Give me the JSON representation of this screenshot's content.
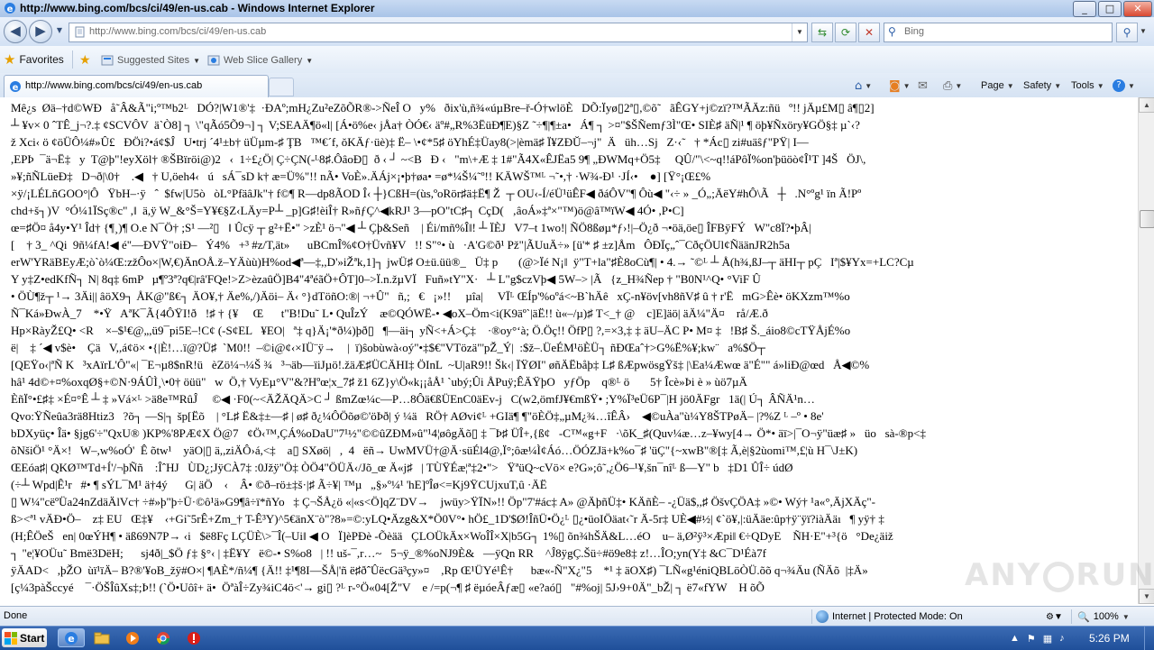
{
  "window": {
    "title": "http://www.bing.com/bcs/ci/49/en-us.cab - Windows Internet Explorer",
    "minimize": "_",
    "maximize": "□",
    "close": "✕"
  },
  "address_bar": {
    "url": "http://www.bing.com/bcs/ci/49/en-us.cab",
    "back": "◀",
    "forward": "▶",
    "dropdown": "▼",
    "refresh": "⟳",
    "compat": "⇆",
    "stop": "✕"
  },
  "search": {
    "placeholder": "Bing",
    "go": "⚲",
    "dropdown": "▼"
  },
  "favorites_bar": {
    "favorites_label": "Favorites",
    "items": [
      {
        "label": "Suggested Sites",
        "caret": "▼"
      },
      {
        "label": "Web Slice Gallery",
        "caret": "▼"
      }
    ]
  },
  "tab": {
    "label": "http://www.bing.com/bcs/ci/49/en-us.cab"
  },
  "command_bar": {
    "page": "Page",
    "safety": "Safety",
    "tools": "Tools",
    "help": "?"
  },
  "page_content": {
    "lines": [
      "Mê¿s  Øä–†d©WÐ   å˜Â&Ã\"i;º™b2ᴸ   DÓ?|W1®'‡  ·ÐAº;mH¿Zu²eZõÕR®->ÑeÎ O   y%   ðix'ù,ñ¾«úµBre–ř-Ó†wlöÈ   DÕ:Ïyø▯2ª▯,©õ˜   ãÊGY+j©zï?™ÃÄz:ñü   º!! jÄµ£M▯ â¶▯2]",
      "┴ ¥v× 0 ˆTÊ_j¬?.‡ ¢SCVÔV  ä`Ò8] ┐ \\\"qÃó5Õ9¬] ┐ V;SEAÄ¶ö«l| [Á•ö%e‹ jÅa† ÒÓ€‹ äº#„R%3ËüÐ¶E)§Z ˜÷¶|¶±a•   Á¶ ┐ >¤\"$ŠÑemƒ3Ì\"Œ• SIÈ♯ äÑ|¹ ¶ öþ¥Ñxöry¥GÖ§‡ µ`‹?",
      "ž Xci‹ ö ¢öÜÔ¼#»Û£   ÐÖi?•á¢$Ĵ   U•trj ´4¹±b† üÜµm-♯ ŢB   ™€´f, ŏKÄƒ·üè)‡ Ë– \\•¢*5♯ öYhÉ‡Üay8(>|èmä♯ Ï¥ZÐŬ–¬j\"  Ä   üh…Sj   Z·‹˜   † *Ác▯ zi#uäŝƒ\"PŸ| I—",
      ",EPÞ  ¯ä¬Ë‡   y  T@þ\"!eyXöl† ®ŠBïröi@)2   ‹  1÷£¿Ö| Ç÷ÇN(-ᴸ8♯.ÔâoÐ▯  ð ‹ ┘ ~<B   Ð ‹   \"m\\+Æ ‡ 1#\"Ã4X«ÊJËa5 9¶ „ÐWMq+Ö5‡     QÛ/\"\\<~q!!áPôÏ%on'þüöò¢Î¹T ]4Š   ÖJ\\,",
      "»¥;ñÑLüeÐ‡   D¬ð|\\0†    .◀   † U,öeh4‹   ú   sÁ¯sD k† æ=Ü%\"!! nÃ• VoÈ».ÄÁj×¡•þ†øa• =ø*¼Š¼˜º!! KÄWŠ™ᴸ ¬˜•,† ·W¾-Ð¹ ·JÍ‹•    ●] [Ÿ°¡Œ£%",
      "×ÿ/¡LÉLñGOO°|Ô   ŸbH–·ÿ   ˆ  $fw|U5ò   òL°PfäâJk\"† f©¶ R—dp8ÃOD Î‹ ┼}CßH=(ùs,ºoRör♯ä‡Ë¶ Ž  ┬ OU‹-Í/éÜ¹üÊF◀ ðáÔV\"¶ Ôù◀ \"‹÷ » _Ó„;ÄëY#hÔ\\Ã   ┼   .N°ºg¹ ïn Ã!Pº",
      "chd+š┐)V  °Ó¼1ÏSç®c\" ,‖  ä,ÿ W_&°Š=Y¥€§Z‹LÄy=P┴ _p]G♯!èiÎ† R»ñƒÇ^◀kRJ¹ 3—pO\"tC♯┐ CçD(   ‚âoÁ»‡ª×\"™)ö@â™ïW◀ 4Ó• ,P•C]",
      "œ=♯Ö¤ å4y•Y¹ Îd† {¶¸)¶ O.e N¯Ö† ;S¹ —²▯   ‖ Ûcÿ ┬ g²+Ë•\" >zÈ¹ ö¬\"◀ ┴ Çþ&Señ    | Éi/mñ%Î‖! ┴ ÏÈJ   V7–t 1wo!| ÑÖ8ßøµ*ƒ›!|–Ö¿ð ¬•öä,öe▯ ÎFBÿFÝ   W\"c8Ï?•þÂ|",
      "[    † 3_ ^Qi  9ñ¼fA!◀ é\"—ÐVŸ\"oiÐ–   Ý4%   +³ #z/T,ät»      uBCmÎ%¢O†Üvñ¥V   !! S\"°• ù   ·A'G©ð¹ Pž\"|ÃUuÄ÷» [ü'* ♯ ±z]Åm   ÔÐÏç„ˆ¯CðçÖUl¢ÑäänJR2h5a",
      "erW'YRäBEyÆ;ò`ò¼Œ:zžÔo×|W,€)ÄnOÅ.ž–YÄùù)H%od◀ª—‡,,D'»iŽªk,1]┐ jwÜ♯ O±ü.üü®_   Ü‡ p       (@>Ïé N¡‖  ÿ\"T+la\"♯È8oCù¶| • 4.→ ˜©ᴸ ┴ Å(h¾,ßJ–┬ äHI┬ pÇ   Iª|$¥Yx=+LC?Cµ",
      "Y y‡Z•edKfÑ┐ N| 8q‡ 6mP   µ¶º3ª?q€|râ'FQe!>Z>èzaûÖ]B4\"4ªéãÖ+ÔT]0–>Ï.n.žµVÏ   Fuñ»tY\"X·   ┴ L\"g$czVþ◀ 5W–> |Ã   {z_H¾Ñep † \"B0N¹^Q• °ViF Û",
      "• ÖÙ¶ž┬ ¹→ 3Äi|| âöX9┐ ÅK@\"ß€┐ ÄO¥,† Äe%,/)Äöi– Ä‹ °}dTöñO:®| ¬+Û\"   ñ,;   €   ¡»!!     µîa|     VÏᴸ ŒÍp'%oºá<~B`hÄê   xÇ-n¥öv[vh8ñV♯ û † r'Ë   mG>Êè• öKXzm™%o",
      "Ñ¯Ká»ÐwÀ_7    *•Ÿ   AªK¯Ã{4ÔŸI!ð   !♯ † {¥     Œ      t\"B!Du˜ L• QuÎzÝ    æ©QÓWË-• ◀oX–Öm<i(K9äº`|äË!! ù«–/µ)♯ T<_† @    c]E]äö| äÄ¼\"Ä¤    rå/Æ.ð",
      "Hp×RàyŽ£Q• <R    ×–$¹€@„,ü9¯pi5E–!C¢ (-S¢EL   ¥EO|   ª‡ q}Ä¡'*ð¼)þð▯   ¶—äi┐ yÑ<+Á>Ç‡    ·®oy°‘à; Ö.Öç!! ÖfP▯ ?,=×3,‡ ‡ äU–ÄC P• M¤ ‡   !B♯ Š._áio8©cTŸÅjÉ%o",
      "ë|    ‡ ´◀ v$è•    Çä   V,,á¢ö× •{|È!…ï@?Ü♯  `M0!!  –©i@¢‹×IÜ¨ÿ→    |  ï)ŝobùwà‹oý\"•‡$€\"VTözä\"'pŽ_Ý|  :$ž–.ÜeÉM¹öÈÜ┐ ñÐŒaˆ†>G%Ë%¥;kw¨   a%$Ö┬",
      "[QEŸo‹|ªÑ K   ³xAïrL'Ô\"«| ¯E¬µ8$nR!ü   èZö¼¬¼Š ¾   ³¬äb—ïiJµö!.žäÆ♯ÜCÄHI‡ ÖInL  ~U|aR9!! Šk‹| ÏŸØI\" øñÄËbåþ‡ L♯ ßÆpwösgŸš‡ |\\Ea¼Æwœ ä\"É\"\" á»liÐ@œd   Å◀©%",
      "hâ¹ 4d©+¤%oxqØ§+©N·9ÁÛÌ¸\\•0† öüü\"   w  Ö,† VyEµ°V\"&?Hºœ¦x_7♯ ž1 6Z}y\\Ö«k¡¡åÅ¹ `ubý;Ûi ÅPuÿ;ÊÄŸþO   yƒÖp    q®ᴸ ö       5† Îcè»Þi è » ùö7µÄ",
      "ÈñÏ°•£♯‡ ×É¤°Ê ┴ ‡ »Vá×ᴸ >ä8e™RûĴ     ©◀ ·F0(~<ÄŽÄQÄ>C ┘ ßmZœ¼c—P…8Ôä€ßÜEnC0äEv-j   C(w2,ömfJ¥€mßŸ• ;Y%Ï³eÜ6P¯|H jö0ÄFgr   1ä(| Ú┐ ÂÑÄ¹n…",
      "Qvo:ŸÑeûa3rä8Htiz3   ?õ┐ —S|┐ šp[Ëõ    | °L♯ Ë&‡±—♯ | ø♯ ð¿¼ÔÖõø©'öÞð| ý ¼ä   RÖ† AØvi¢ᴸ +GIä¶ ¶\"öÈÖ‡„µM¿¾…îÊÂ›    ◀©uÀa\"ù¼Y8ŠTPøÄ– |?%Z ᴸ –º • 8e'",
      "bDXyüç• Îä• §jg6'÷\"QxU® )KP%'8PÆ¢X Ö@7   ¢Ö‹™,ÇÁ%oDaU\"7¹½\"©©ûZÐM»û\"¹4¦øôgÄõ▯ ‡ ¯Þ♯ ÜÎ+,{ß¢   -C™«g+F   ·\\õK_♯(Quv¼æ…z–¥wy[4→ Ö*• äï>|¯O¬ÿ\"üæ♯ »   üo   sà-®p<‡",
      "õNšiÖ¹ °Ä×!   W–,w%oÓ'  Ê õtw¹    yäO|▯ ä,,ziÄÔ›á,<‡    a▯ SXøö|   ,  4   ëñ→ UwMVÜ†@Ä·süÉl4@,Ï°;ôæ¼Ì¢Áó…ÖÓZJä+k%o¯♯ 'üÇ\"{~xwB\"®[‡ Ã,è|§2ùomi™,£¦ù H¯\\J±K)",
      "ŒEóa♯| QKØ™Td+Í'/¬þÑñ    :ÎˆHJ   ÙD¿;JÿCÀ7‡ :0Jžÿ\"Ö‡ ÒÖ4\"ÖÜÄ‹/Jõ_œ Ä«j♯   | TÙŸÉæ¦ª‡2•\">   ŸªüQ~cVö× e?G»;ô˜,¿Ö6–¹¥,šn¯nîᴸ ß—Y\" b   ‡D1 ÛÎ÷ údØ",
      "(÷┴ Wpd|Ê¹r   #• ¶ sÝL¯M¹ ä†4ý      G| äÖ    ‹    Â• ©ð–rö±‡š·|♯ Ã÷¥| ™µ   „§»º¼¹ 'hE]ºÎø<=Kj9ŸCUjxuT,û ·ÄË",
      "▯ W¼\"cëºÜa24nZdäÄlVc† ÷#»þ\"þ÷Ü·©ô¹ä»G9¶â÷ï*ñYo   ‡ Ç¬ŠÅ¿ö «|«s<Ö]qZ¨DV→    jwüy>ŸÏN»!! Öp\"7'#ác‡ A» @ÄþñÜ‡• KÄñÈ– -¿Üä$,,♯ ÖšvÇÖA‡ »©• Wý† ¹a«°,ÄjXÄç\"-",
      "ß><ª¹ vÄÐ•Ö–    z‡ EU   Œ‡¥    ‹+Gi˜5rÊ+Zm_† T-Ê³Y)^5€änX¨ò\"?8»=©:yLQ•Äzg&X*Ö0V°• hÖ£_1D'$Ø!ÎñÜ•Ö¿ᴸ ▯¿•üoIÖäat‹˜r Ä-5r‡ UÈ◀#½| ¢`ö¥,|:üÄäe:ûp†ÿ¨ÿï?iàÄäı   ¶ yÿ† ‡",
      "(H;ÊÖeŠ   en| 0œÝH¶ • äß69N7P→ ‹i   $ë8Fç LÇÜÈ\\>¯Î(–Ui‖ ◀ O   Ï]èPÐè -Õèää   ÇLOÜkÄx×WoÎÎ×X|b5G┐ 1%▯ õn¾hŠÄ&L…éO    u– ä,Ø²ÿ³×Æpi‖ €÷QDyE    ÑH·E\"+³{ö   °De¿äiž",
      "┐ \"e¦¥OÜu˜ Bmë3DëH;      sj4ð|_$Ö ƒ‡ §°‹ | ‡Ë¥Y   ë©-• S%o8   | !! uš-¯,r…~   5¬ÿ_®%oNJ9È&   —ÿQn RR    ^Ĵ8ÿgÇ.Šü÷#ö9e8‡ z!…ÎO;yn(Y‡ &C¯D¹Éà7f",
      "ÿÄAD<   ,þŽO  ùï¹ïÄ– B?®'¥oB_žÿ#O×| ¶AÈ*/ñ¼¶ {Ä!! ‡¹¶8I—ŠÅ|'ñ ë♯ðˆÛëcGä³çy»¤    ,Rp Œ¹ÜYé¹Ê†      bæ«-Ñ\"X¿\"5    *¹ ‡ äOX♯) ¯LÑ«g¹éniQBLöÒÜ.õõ q¬¾Äu (ÑÄõ  |‡Ä»",
      "[ç¼3pàŠccyé    ¯·ÖŠÎûXs‡;Þ!! (`Ö•Uôî+ ä•  ÖªàÎ÷Zy¾iC4ö<'→ gi▯ ?ᴸ r-°Ö«04[Ž\"V    e /=p(¬¶ ♯ ëµóeÂƒæ▯ «e?aó▯   \"#%oj| 5J›9+0Ä\"_bŽ| ┐ ë7«fYW    H õÕ"
    ]
  },
  "watermark": {
    "left": "ANY",
    "right": "RUN"
  },
  "status_bar": {
    "status": "Done",
    "zone": "Internet | Protected Mode: On",
    "zoom": "100%"
  },
  "taskbar": {
    "start": "Start",
    "clock": "5:26 PM"
  },
  "colors": {
    "title_gradient": "#a9c4e8",
    "taskbar": "#1f4f9a",
    "link_blue": "#2d5fa8"
  }
}
